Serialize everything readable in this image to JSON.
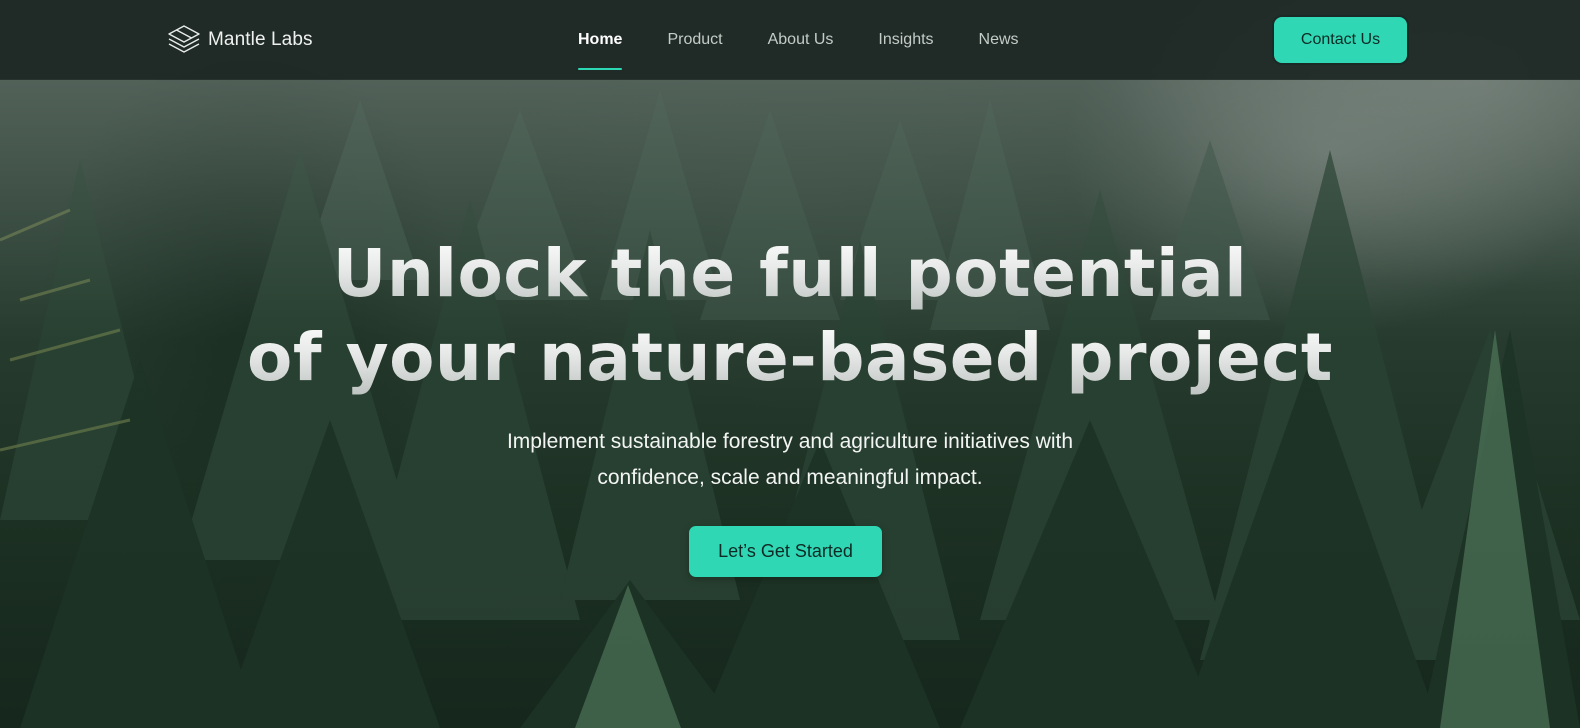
{
  "brand": {
    "name": "Mantle Labs",
    "icon": "layered-diamond-logo-icon"
  },
  "nav": {
    "items": [
      {
        "label": "Home",
        "active": true
      },
      {
        "label": "Product",
        "active": false
      },
      {
        "label": "About Us",
        "active": false
      },
      {
        "label": "Insights",
        "active": false
      },
      {
        "label": "News",
        "active": false
      }
    ],
    "contact_label": "Contact Us"
  },
  "hero": {
    "title_line_1": "Unlock the full potential",
    "title_line_2": "of your nature-based project",
    "subtitle_line_1": "Implement sustainable forestry and agriculture initiatives with",
    "subtitle_line_2": "confidence, scale and meaningful impact.",
    "cta_label": "Let’s Get Started",
    "background": "misty-pine-forest"
  },
  "colors": {
    "accent": "#2fd7b4",
    "header_bg": "#1e2825",
    "active_underline": "#2bd8b3",
    "button_text": "#0e2a24"
  }
}
